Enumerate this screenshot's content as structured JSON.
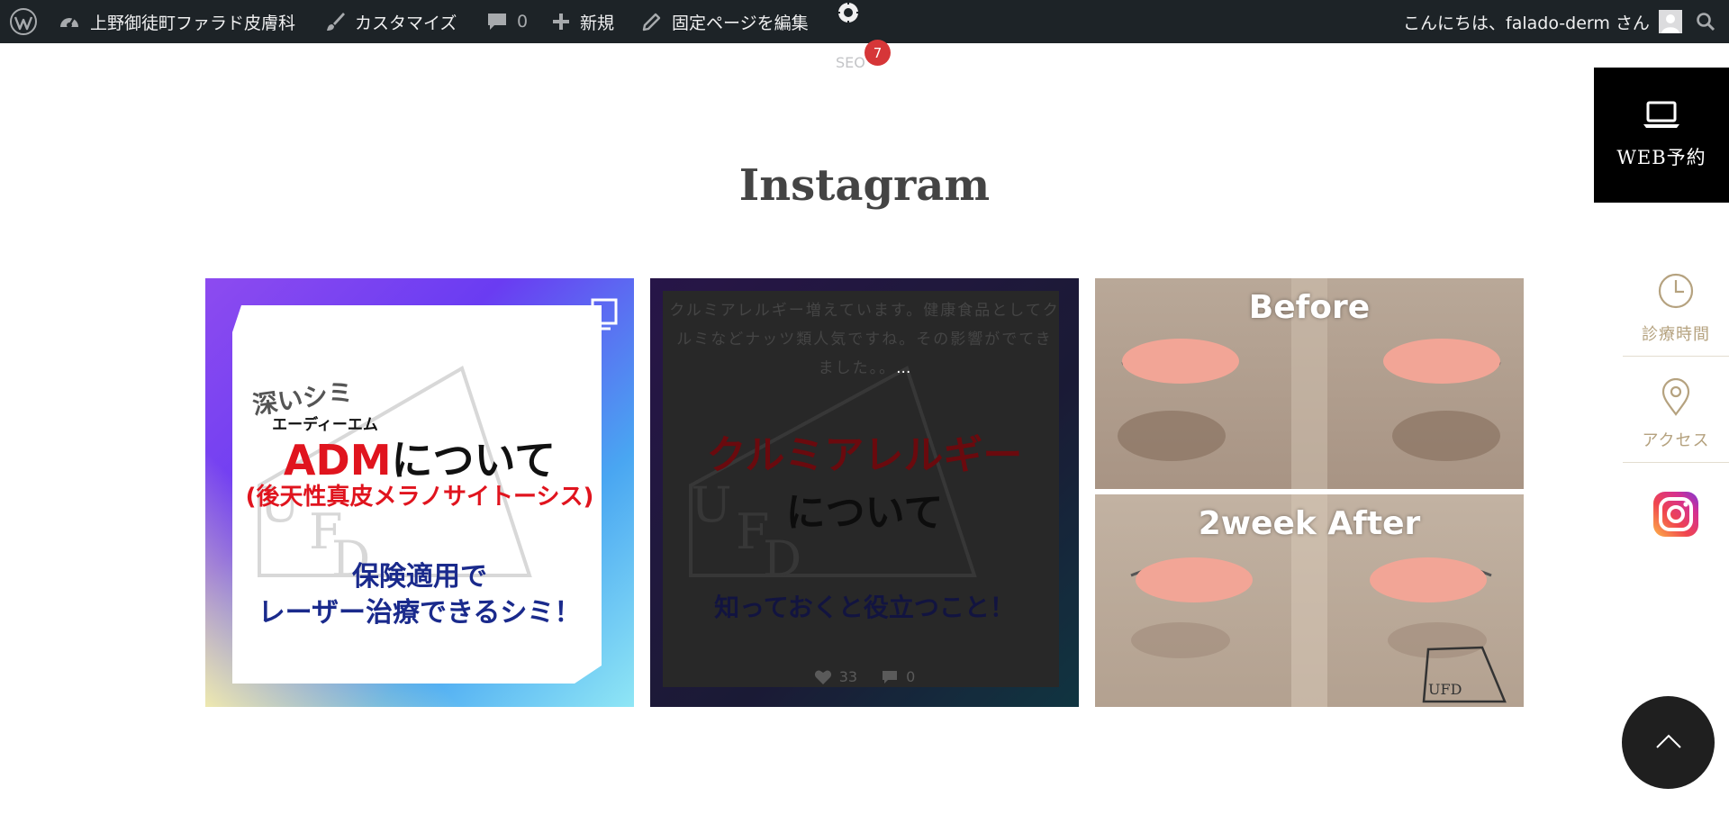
{
  "adminbar": {
    "site_name": "上野御徒町ファラド皮膚科",
    "customize": "カスタマイズ",
    "comments_count": "0",
    "new_label": "新規",
    "edit_page": "固定ページを編集",
    "seo_label": "SEO",
    "seo_badge": "7",
    "greeting": "こんにちは、falado-derm さん"
  },
  "section": {
    "title": "Instagram"
  },
  "posts": [
    {
      "line_small1": "深いシミ",
      "line_small2": "エーディーエム",
      "line_main_red": "ADM",
      "line_main_black": "について",
      "line_sub": "(後天性真皮メラノサイトーシス)",
      "line_blue1": "保険適用で",
      "line_blue2": "レーザー治療できるシミ！"
    },
    {
      "caption_line1": "クルミアレルギー増えています。健康食品としてク",
      "caption_line2": "ルミなどナッツ類人気ですね。その影響がでてき",
      "caption_line3": "ました。。",
      "ellipsis": "...",
      "title_red": "クルミアレルギー",
      "title_black": "について",
      "subtitle": "知っておくと役立つこと！",
      "likes": "33",
      "comments": "0"
    },
    {
      "top_label": "Before",
      "bottom_label": "2week After"
    }
  ],
  "side": {
    "web_booking": "WEB予約",
    "hours": "診療時間",
    "access": "アクセス"
  },
  "colors": {
    "adminbar_bg": "#1d2327",
    "badge": "#d63638",
    "gold": "#b5a27f",
    "red_text": "#e0141e",
    "blue_text": "#1a2a8c"
  },
  "icons": [
    "wordpress-icon",
    "dashboard-icon",
    "brush-icon",
    "comment-icon",
    "plus-icon",
    "pencil-icon",
    "gear-icon",
    "avatar",
    "search-icon",
    "multi-image-icon",
    "heart-icon",
    "laptop-icon",
    "clock-icon",
    "location-pin-icon",
    "instagram-icon",
    "chevron-up-icon"
  ]
}
